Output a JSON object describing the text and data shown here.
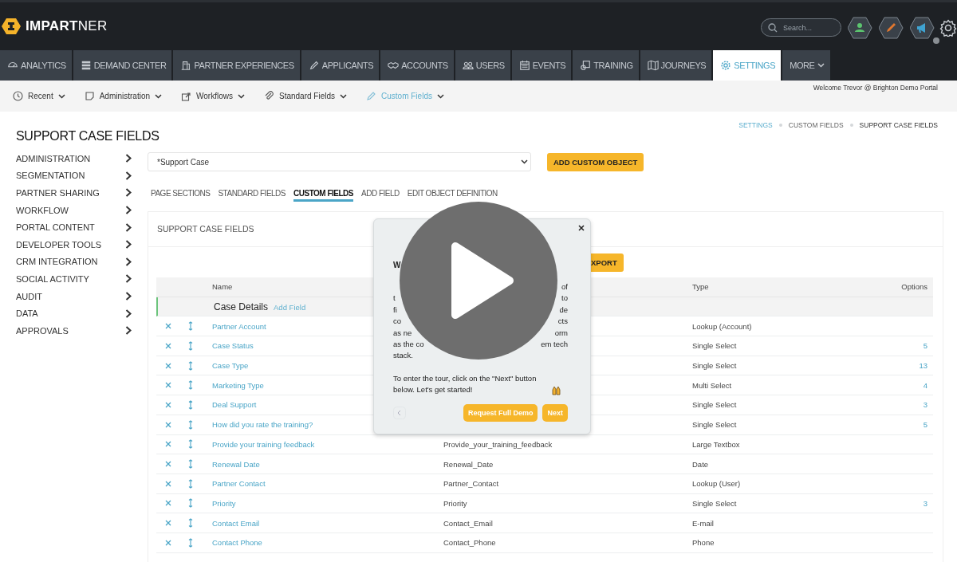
{
  "header": {
    "logo": "**IMPART**NER",
    "search": {
      "placeholder": "Search..."
    }
  },
  "nav_tabs": [
    {
      "label": "ANALYTICS",
      "selected": false,
      "dropdown": false
    },
    {
      "label": "DEMAND CENTER",
      "selected": false,
      "dropdown": false
    },
    {
      "label": "PARTNER EXPERIENCES",
      "selected": false,
      "dropdown": false
    },
    {
      "label": "APPLICANTS",
      "selected": false,
      "dropdown": false
    },
    {
      "label": "ACCOUNTS",
      "selected": false,
      "dropdown": false
    },
    {
      "label": "USERS",
      "selected": false,
      "dropdown": false
    },
    {
      "label": "EVENTS",
      "selected": false,
      "dropdown": false
    },
    {
      "label": "TRAINING",
      "selected": false,
      "dropdown": false
    },
    {
      "label": "JOURNEYS",
      "selected": false,
      "dropdown": false
    },
    {
      "label": "SETTINGS",
      "selected": true,
      "dropdown": false
    },
    {
      "label": "MORE",
      "selected": false,
      "dropdown": true
    }
  ],
  "subnav": [
    {
      "label": "Recent",
      "selected": false
    },
    {
      "label": "Administration",
      "selected": false
    },
    {
      "label": "Workflows",
      "selected": false
    },
    {
      "label": "Standard Fields",
      "selected": false
    },
    {
      "label": "Custom Fields",
      "selected": true
    }
  ],
  "welcome": "Welcome Trevor @ Brighton Demo Portal",
  "page_title": "SUPPORT CASE FIELDS",
  "breadcrumb": [
    {
      "label": "SETTINGS",
      "kind": "link"
    },
    {
      "label": "CUSTOM FIELDS",
      "kind": "plain"
    },
    {
      "label": "SUPPORT CASE FIELDS",
      "kind": "current"
    }
  ],
  "sidebar": [
    "ADMINISTRATION",
    "SEGMENTATION",
    "PARTNER SHARING",
    "WORKFLOW",
    "PORTAL CONTENT",
    "DEVELOPER TOOLS",
    "CRM INTEGRATION",
    "SOCIAL ACTIVITY",
    "AUDIT",
    "DATA",
    "APPROVALS"
  ],
  "object_select": {
    "value": "*Support Case"
  },
  "add_object_button": "ADD CUSTOM OBJECT",
  "subtabs": [
    {
      "label": "PAGE SECTIONS",
      "selected": false
    },
    {
      "label": "STANDARD FIELDS",
      "selected": false
    },
    {
      "label": "CUSTOM FIELDS",
      "selected": true
    },
    {
      "label": "ADD FIELD",
      "selected": false
    },
    {
      "label": "EDIT OBJECT DEFINITION",
      "selected": false
    }
  ],
  "panel": {
    "title": "SUPPORT CASE FIELDS",
    "export_button": "XPORT",
    "columns": {
      "name": "Name",
      "type": "Type",
      "options": "Options"
    },
    "group": {
      "title": "Case Details",
      "action": "Add Field"
    },
    "rows": [
      {
        "name": "Partner Account",
        "type": "Lookup (Account)"
      },
      {
        "name": "Case Status",
        "type": "Single Select",
        "options": "5"
      },
      {
        "name": "Case Type",
        "type": "Single Select",
        "options": "13"
      },
      {
        "name": "Marketing Type",
        "type": "Multi Select",
        "options": "4"
      },
      {
        "name": "Deal Support",
        "type": "Single Select",
        "options": "3"
      },
      {
        "name": "How did you rate the training?",
        "type": "Single Select",
        "options": "5"
      },
      {
        "name": "Provide your training feedback",
        "api_name": "Provide_your_training_feedback",
        "type": "Large Textbox"
      },
      {
        "name": "Renewal Date",
        "api_name": "Renewal_Date",
        "type": "Date"
      },
      {
        "name": "Partner Contact",
        "api_name": "Partner_Contact",
        "type": "Lookup (User)"
      },
      {
        "name": "Priority",
        "api_name": "Priority",
        "type": "Single Select",
        "options": "3"
      },
      {
        "name": "Contact Email",
        "api_name": "Contact_Email",
        "type": "E-mail"
      },
      {
        "name": "Contact Phone",
        "api_name": "Contact_Phone",
        "type": "Phone"
      }
    ]
  },
  "tour_popup": {
    "title_fragment": "W",
    "lines": [
      {
        "right": "of"
      },
      {
        "left": "t",
        "right": "to"
      },
      {
        "left": "fi",
        "right": "de"
      },
      {
        "left": "co",
        "right": "cts"
      },
      {
        "left": "as ne",
        "right": "orm"
      },
      {
        "left": "as the co",
        "right": "em tech"
      },
      {
        "left": "stack."
      }
    ],
    "cta": "To enter the tour, click on the \"Next\" button below. Let's get started!",
    "request_button": "Request Full Demo",
    "next_button": "Next"
  }
}
